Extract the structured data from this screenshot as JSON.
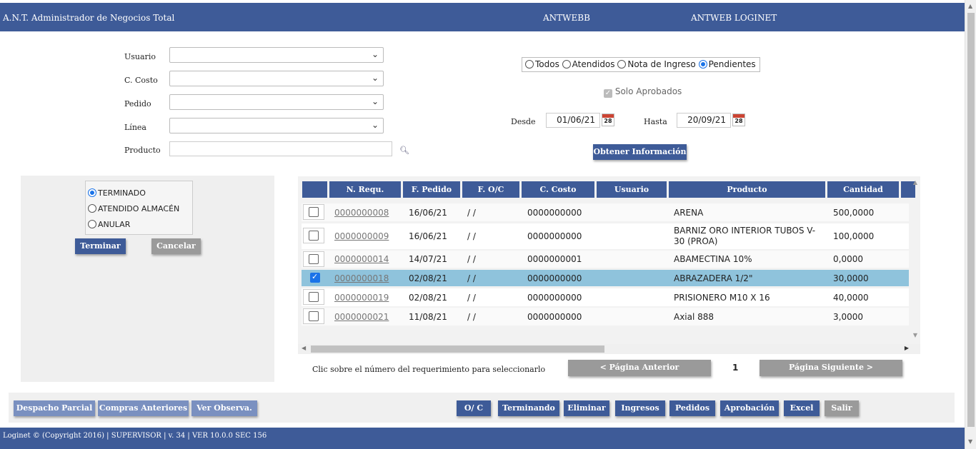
{
  "header": {
    "title": "A.N.T. Administrador de Negocios Total",
    "center": "ANTWEBB",
    "right": "ANTWEB LOGINET"
  },
  "filters": {
    "usuario_label": "Usuario",
    "costo_label": "C. Costo",
    "pedido_label": "Pedido",
    "linea_label": "Línea",
    "producto_label": "Producto"
  },
  "status_options": {
    "todos": "Todos",
    "atendidos": "Atendidos",
    "nota": "Nota de Ingreso",
    "pendientes": "Pendientes",
    "selected": "Pendientes"
  },
  "solo_aprobados": "Solo Aprobados",
  "dates": {
    "desde_label": "Desde",
    "desde_value": "01/06/21",
    "hasta_label": "Hasta",
    "hasta_value": "20/09/21",
    "calendar_day": "28"
  },
  "obtener_button": "Obtener Información",
  "action_panel": {
    "options": [
      "TERMINADO",
      "ATENDIDO ALMACÉN",
      "ANULAR"
    ],
    "selected": "TERMINADO",
    "terminar_button": "Terminar",
    "cancelar_button": "Cancelar"
  },
  "table": {
    "columns": [
      "",
      "N. Requ.",
      "F. Pedido",
      "F. O/C",
      "C. Costo",
      "Usuario",
      "Producto",
      "Cantidad"
    ],
    "rows": [
      {
        "checked": false,
        "req": "0000000008",
        "fpedido": "16/06/21",
        "foc": "/ /",
        "costo": "0000000000",
        "usuario": "",
        "producto": "ARENA",
        "cantidad": "500,0000"
      },
      {
        "checked": false,
        "req": "0000000009",
        "fpedido": "16/06/21",
        "foc": "/ /",
        "costo": "0000000000",
        "usuario": "",
        "producto": "BARNIZ ORO INTERIOR TUBOS V-30 (PROA)",
        "cantidad": "100,0000"
      },
      {
        "checked": false,
        "req": "0000000014",
        "fpedido": "14/07/21",
        "foc": "/ /",
        "costo": "0000000001",
        "usuario": "",
        "producto": "ABAMECTINA 10%",
        "cantidad": "0,0000"
      },
      {
        "checked": true,
        "req": "0000000018",
        "fpedido": "02/08/21",
        "foc": "/ /",
        "costo": "0000000000",
        "usuario": "",
        "producto": "ABRAZADERA 1/2\"",
        "cantidad": "30,0000"
      },
      {
        "checked": false,
        "req": "0000000019",
        "fpedido": "02/08/21",
        "foc": "/ /",
        "costo": "0000000000",
        "usuario": "",
        "producto": "PRISIONERO M10 X 16",
        "cantidad": "40,0000"
      },
      {
        "checked": false,
        "req": "0000000021",
        "fpedido": "11/08/21",
        "foc": "/ /",
        "costo": "0000000000",
        "usuario": "",
        "producto": "Axial 888",
        "cantidad": "3,0000"
      }
    ]
  },
  "hint": "Clic sobre el número del requerimiento para seleccionarlo",
  "pagination": {
    "prev": "< Página Anterior",
    "page": "1",
    "next": "Página Siguiente >"
  },
  "bottom_left_buttons": [
    "Despacho Parcial",
    "Compras Anteriores",
    "Ver Observa."
  ],
  "bottom_right_buttons": [
    "O/ C",
    "Terminando",
    "Eliminar",
    "Ingresos",
    "Pedidos",
    "Aprobación",
    "Excel",
    "Salir"
  ],
  "footer": "Loginet © (Copyright 2016) | SUPERVISOR | v. 34 | VER 10.0.0 SEC 156",
  "colors": {
    "primary": "#3e5b98",
    "selected_row": "#8fc3dc"
  }
}
